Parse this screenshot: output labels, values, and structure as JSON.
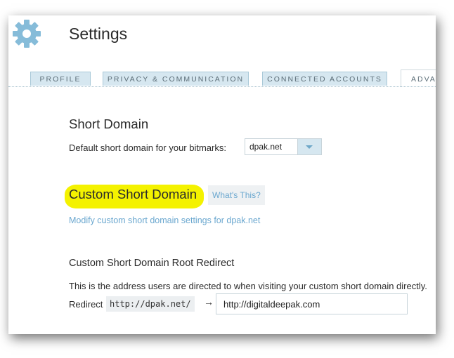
{
  "header": {
    "title": "Settings",
    "icon": "gear-icon"
  },
  "tabs": [
    {
      "label": "PROFILE"
    },
    {
      "label": "PRIVACY & COMMUNICATION"
    },
    {
      "label": "CONNECTED ACCOUNTS"
    },
    {
      "label": "ADVANCED"
    }
  ],
  "short_domain": {
    "heading": "Short Domain",
    "label": "Default short domain for your bitmarks:",
    "selected": "dpak.net"
  },
  "custom_domain": {
    "heading": "Custom Short Domain",
    "whats_this": "What's This?",
    "modify_link": "Modify custom short domain settings for dpak.net"
  },
  "root_redirect": {
    "heading": "Custom Short Domain Root Redirect",
    "description": "This is the address users are directed to when visiting your custom short domain directly.",
    "redirect_label": "Redirect",
    "prefix": "http://dpak.net/",
    "arrow": "→",
    "value": "http://digitaldeepak.com"
  },
  "colors": {
    "accent": "#6aa7cf",
    "tab_bg": "#d6e7f0",
    "highlight": "#f4f200"
  }
}
